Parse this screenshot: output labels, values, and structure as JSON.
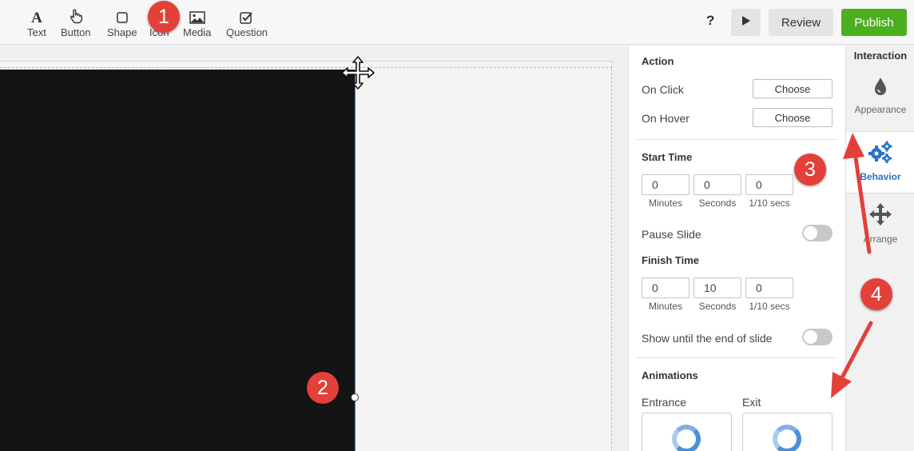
{
  "toolbar": {
    "tools": [
      {
        "label": "Text",
        "icon": "text-icon"
      },
      {
        "label": "Button",
        "icon": "hand-pointer-icon"
      },
      {
        "label": "Shape",
        "icon": "square-icon"
      },
      {
        "label": "Icon",
        "icon": "icon-tool-icon"
      },
      {
        "label": "Media",
        "icon": "image-icon"
      },
      {
        "label": "Question",
        "icon": "checkbox-icon"
      }
    ],
    "help": "?",
    "play_icon": "play-icon",
    "review_label": "Review",
    "publish_label": "Publish"
  },
  "panel": {
    "action": {
      "title": "Action",
      "on_click_label": "On Click",
      "on_click_button": "Choose",
      "on_hover_label": "On Hover",
      "on_hover_button": "Choose"
    },
    "start_time": {
      "title": "Start Time",
      "minutes": "0",
      "seconds": "0",
      "tenths": "0",
      "units": [
        "Minutes",
        "Seconds",
        "1/10 secs"
      ]
    },
    "pause_slide": {
      "label": "Pause Slide",
      "on": false
    },
    "finish_time": {
      "title": "Finish Time",
      "minutes": "0",
      "seconds": "10",
      "tenths": "0",
      "units": [
        "Minutes",
        "Seconds",
        "1/10 secs"
      ]
    },
    "show_until_end": {
      "label": "Show until the end of slide",
      "on": false
    },
    "animations": {
      "title": "Animations",
      "entrance_label": "Entrance",
      "exit_label": "Exit"
    }
  },
  "tabs": {
    "title": "Interaction",
    "items": [
      {
        "label": "Appearance",
        "icon": "droplet-icon",
        "active": false
      },
      {
        "label": "Behavior",
        "icon": "gears-icon",
        "active": true
      },
      {
        "label": "Arrange",
        "icon": "move-icon",
        "active": false
      }
    ]
  },
  "callouts": [
    "1",
    "2",
    "3",
    "4"
  ],
  "colors": {
    "accent": "#2a73c7",
    "publish": "#4caf1f",
    "callout": "#e3403a"
  }
}
